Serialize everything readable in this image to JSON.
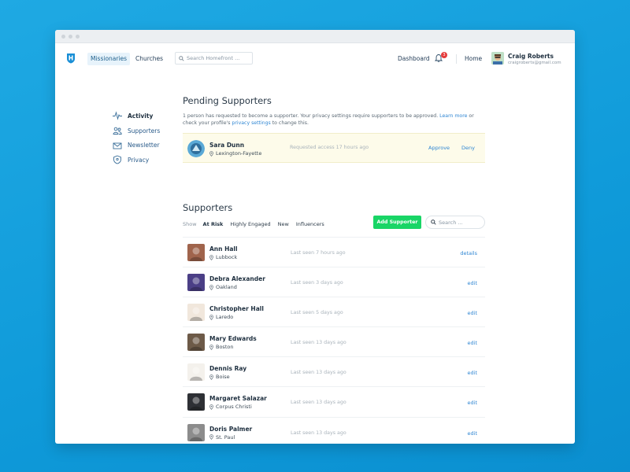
{
  "nav": {
    "items": [
      {
        "label": "Missionaries",
        "active": true
      },
      {
        "label": "Churches",
        "active": false
      }
    ],
    "search_placeholder": "Search Homefront ...",
    "dashboard_label": "Dashboard",
    "notification_count": "3",
    "home_label": "Home",
    "user": {
      "name": "Craig Roberts",
      "email": "craigroberts@gmail.com"
    }
  },
  "sidebar": {
    "items": [
      {
        "label": "Activity",
        "icon": "pulse-icon",
        "active": true
      },
      {
        "label": "Supporters",
        "icon": "people-icon",
        "active": false
      },
      {
        "label": "Newsletter",
        "icon": "envelope-icon",
        "active": false
      },
      {
        "label": "Privacy",
        "icon": "shield-icon",
        "active": false
      }
    ]
  },
  "pending": {
    "title": "Pending Supporters",
    "info_part1": "1 person has requested to become a supporter. Your privacy settings require supporters to be approved.",
    "learn_more": "Learn more",
    "info_part2": "or check your profile's",
    "privacy_settings": "privacy settings",
    "info_part3": "to change this.",
    "request": {
      "name": "Sara Dunn",
      "location": "Lexington-Fayette",
      "status": "Requested access 17 hours ago",
      "approve_label": "Approve",
      "deny_label": "Deny"
    }
  },
  "supporters": {
    "title": "Supporters",
    "show_label": "Show",
    "filters": [
      {
        "label": "At Risk",
        "active": true
      },
      {
        "label": "Highly Engaged",
        "active": false
      },
      {
        "label": "New",
        "active": false
      },
      {
        "label": "Influencers",
        "active": false
      }
    ],
    "add_label": "Add Supporter",
    "search_placeholder": "Search ...",
    "rows": [
      {
        "name": "Ann Hall",
        "location": "Lubbock",
        "status": "Last seen 7 hours ago",
        "action": "details",
        "avatar_color": "#a0644c"
      },
      {
        "name": "Debra Alexander",
        "location": "Oakland",
        "status": "Last seen 3 days ago",
        "action": "edit",
        "avatar_color": "#4b3f86"
      },
      {
        "name": "Christopher Hall",
        "location": "Laredo",
        "status": "Last seen 5 days ago",
        "action": "edit",
        "avatar_color": "#f1e7dc"
      },
      {
        "name": "Mary Edwards",
        "location": "Boston",
        "status": "Last seen 13 days ago",
        "action": "edit",
        "avatar_color": "#6d5a48"
      },
      {
        "name": "Dennis Ray",
        "location": "Boise",
        "status": "Last seen 13 days ago",
        "action": "edit",
        "avatar_color": "#f4f1ec"
      },
      {
        "name": "Margaret Salazar",
        "location": "Corpus Christi",
        "status": "Last seen 13 days ago",
        "action": "edit",
        "avatar_color": "#2e3035"
      },
      {
        "name": "Doris Palmer",
        "location": "St. Paul",
        "status": "Last seen 13 days ago",
        "action": "edit",
        "avatar_color": "#8c8c8c"
      }
    ]
  },
  "colors": {
    "accent": "#2f86d3",
    "add_button": "#19d566",
    "badge": "#e53b3b",
    "pending_bg": "#fdfbea"
  }
}
